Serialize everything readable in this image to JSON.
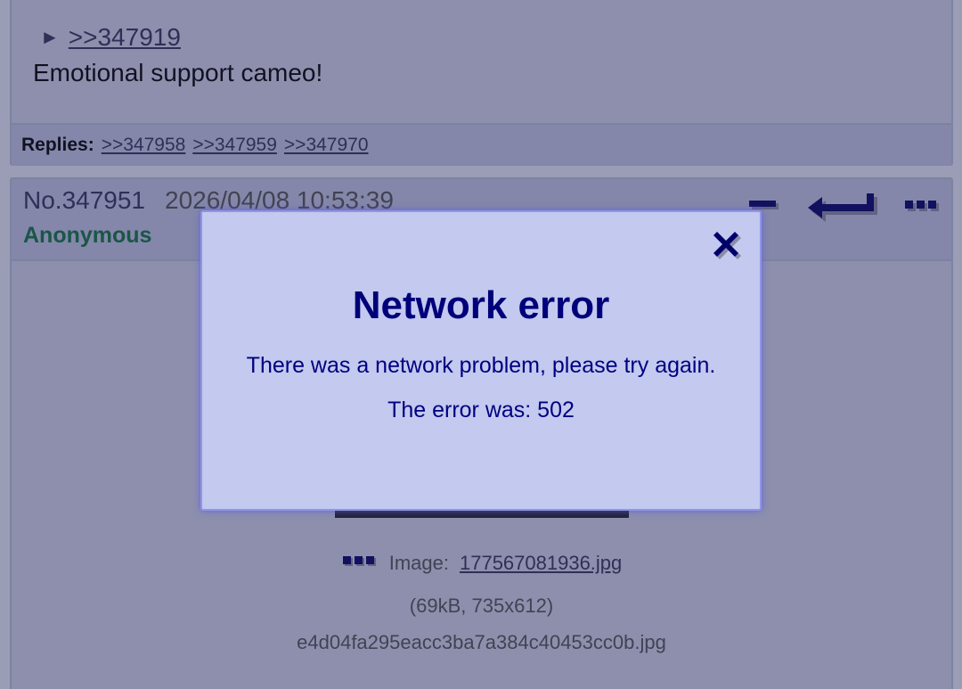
{
  "previous_post": {
    "quote_arrow": "►",
    "quote_link": ">>347919",
    "comment": "Emotional support cameo!",
    "replies_label": "Replies:",
    "replies": [
      ">>347958",
      ">>347959",
      ">>347970"
    ]
  },
  "current_post": {
    "number": "No.347951",
    "date": "2026/04/08 10:53:39",
    "name": "Anonymous",
    "file": {
      "label": "Image:",
      "filename": "177567081936.jpg",
      "meta": "(69kB, 735x612)",
      "original_name": "e4d04fa295eacc3ba7a384c40453cc0b.jpg"
    }
  },
  "modal": {
    "title": "Network error",
    "message": "There was a network problem, please try again.",
    "error_line": "The error was: 502"
  },
  "colors": {
    "post_bg": "#d6daf0",
    "header_bg": "#c7cbe8",
    "name_green": "#117743",
    "modal_bg": "#c3c9ef",
    "modal_text": "#000080"
  },
  "icons": {
    "hide": "minus-icon",
    "reply": "reply-arrow-icon",
    "menu": "ellipsis-icon",
    "close": "close-icon"
  }
}
